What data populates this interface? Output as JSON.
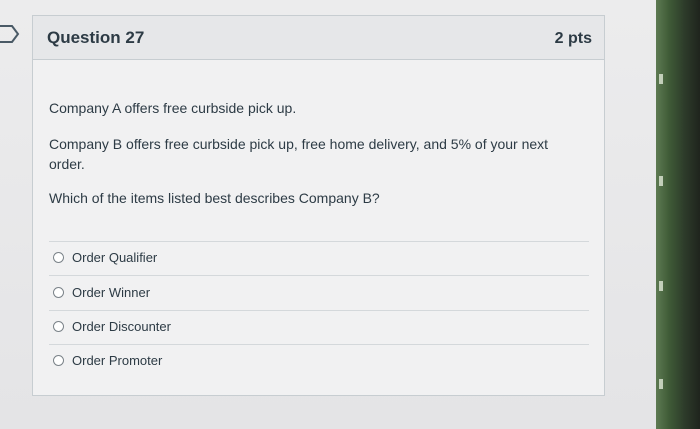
{
  "question": {
    "title": "Question 27",
    "points": "2 pts",
    "paragraphs": [
      "Company A offers free curbside pick up.",
      "Company B offers free curbside pick up, free home delivery, and 5% of your next order.",
      "Which of the items listed best describes Company B?"
    ],
    "answers": [
      {
        "label": "Order Qualifier",
        "selected": false
      },
      {
        "label": "Order Winner",
        "selected": false
      },
      {
        "label": "Order Discounter",
        "selected": false
      },
      {
        "label": "Order Promoter",
        "selected": false
      }
    ]
  },
  "icons": {
    "bookmark": "bookmark-flag-icon",
    "radio": "radio-unselected-icon"
  },
  "colors": {
    "text": "#2d3b45",
    "card_border": "#c7cdd1",
    "header_bg": "#e6e7e9"
  }
}
